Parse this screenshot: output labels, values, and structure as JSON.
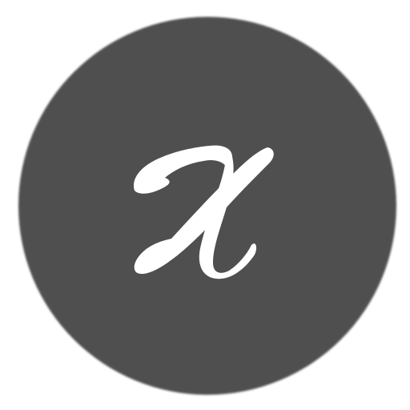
{
  "logo": {
    "icon": "script-x-monogram-icon",
    "letter": "x",
    "circle_color": "#505050",
    "letter_color": "#ffffff",
    "background_color": "#ffffff"
  }
}
